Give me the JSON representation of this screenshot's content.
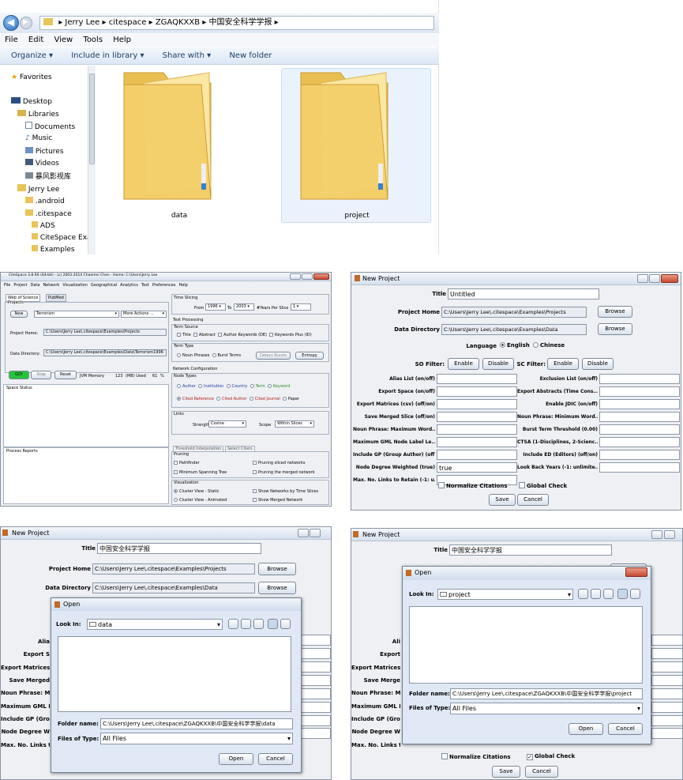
{
  "explorer": {
    "breadcrumb": [
      "Jerry Lee",
      "citespace",
      "ZGAQKXXB",
      "中国安全科学学报"
    ],
    "menu": [
      "File",
      "Edit",
      "View",
      "Tools",
      "Help"
    ],
    "toolbar": [
      "Organize",
      "Include in library",
      "Share with",
      "New folder"
    ],
    "nav": {
      "favorites": "Favorites",
      "desktop": "Desktop",
      "libraries": "Libraries",
      "documents": "Documents",
      "music": "Music",
      "pictures": "Pictures",
      "videos": "Videos",
      "baofeng": "暴风影视库",
      "user": "Jerry Lee",
      "android": ".android",
      "citespace": ".citespace",
      "ads": "ADS",
      "citespace_exa": "CiteSpace Exa",
      "examples": "Examples"
    },
    "folders": [
      "data",
      "project"
    ]
  },
  "citespace": {
    "title": "CiteSpace 3.8.R6 (64-bit) - (c) 2003-2014 Chaomei Chen - Home: C:\\Users\\Jerry Lee",
    "menu": [
      "File",
      "Project",
      "Data",
      "Network",
      "Visualization",
      "Geographical",
      "Analytics",
      "Text",
      "Preferences",
      "Help"
    ],
    "tabs": [
      "Web of Science",
      "PubMed"
    ],
    "projects_label": "Projects",
    "new_btn": "New",
    "project_name": "Terrorism",
    "more_actions": "More Actions ...",
    "project_home_label": "Project Home:",
    "project_home": "C:\\Users\\Jerry Lee\\.citespace\\Examples\\Projects",
    "data_dir_label": "Data Directory:",
    "data_dir": "C:\\Users\\Jerry Lee\\.citespace\\Examples\\Data\\Terrorism1996",
    "go": "GO!",
    "stop": "Stop",
    "reset": "Reset",
    "jvm": "JVM Memory",
    "mem": "123",
    "mb_used": "(MB) Used",
    "pct": "61",
    "pct_sign": "%",
    "space_status": "Space Status",
    "process_reports": "Process Reports",
    "time_slicing": "Time Slicing",
    "from": "From",
    "from_val": "1996",
    "to": "To",
    "to_val": "2003",
    "years_per": "#Years Per Slice",
    "yps_val": "1",
    "text_processing": "Text Processing",
    "term_source": "Term Source",
    "term_sources": [
      "Title",
      "Abstract",
      "Author Keywords (DE)",
      "Keywords Plus (ID)"
    ],
    "term_type": "Term Type",
    "term_types": [
      "Noun Phrases",
      "Burst Terms"
    ],
    "detect_bursts": "Detect Bursts",
    "entropy": "Entropy",
    "network_config": "Network Configuration",
    "node_types": "Node Types",
    "node_row1": [
      "Author",
      "Institution",
      "Country",
      "Term",
      "Keyword"
    ],
    "node_row2": [
      "Cited Reference",
      "Cited Author",
      "Cited Journal",
      "Paper"
    ],
    "links": "Links",
    "strength": "Strength",
    "strength_val": "Cosine",
    "scope": "Scope",
    "scope_val": "Within Slices",
    "tab_threshold": "Threshold Interpolation",
    "tab_select": "Select Citers",
    "pruning": "Pruning",
    "prune": [
      "Pathfinder",
      "Pruning sliced networks",
      "Minimum Spanning Tree",
      "Pruning the merged network"
    ],
    "visualization": "Visualization",
    "vis": [
      "Cluster View - Static",
      "Show Networks by Time Slices",
      "Cluster View - Animated",
      "Show Merged Network"
    ]
  },
  "newproj1": {
    "window_title": "New Project",
    "title_label": "Title",
    "title_val": "Untitled",
    "ph_label": "Project Home",
    "ph_val": "C:\\Users\\Jerry Lee\\.citespace\\Examples\\Projects",
    "browse": "Browse",
    "dd_label": "Data Directory",
    "dd_val": "C:\\Users\\Jerry Lee\\.citespace\\Examples\\Data",
    "lang_label": "Language",
    "lang_en": "English",
    "lang_cn": "Chinese",
    "so_label": "SO Filter:",
    "sc_label": "SC Filter:",
    "enable": "Enable",
    "disable": "Disable",
    "left_labels": [
      "Alias List (on/off)",
      "Export Space (on/off)",
      "Export Matrices (csv) (off/on)",
      "Save Merged Slice (off/on)",
      "Noun Phrase: Maximum Word...",
      "Maximum GML Node Label Le...",
      "Include GP (Group Author) (off...",
      "Node Degree Weighted (true)",
      "Max. No. Links to Retain (-1: u..."
    ],
    "left_vals": [
      "",
      "",
      "",
      "",
      "",
      "",
      "",
      "true",
      ""
    ],
    "right_labels": [
      "Exclusion List (on/off)",
      "Export Abstracts (Time Cons...",
      "Enable JDIC (on/off)",
      "Noun Phrase: Minimum Word...",
      "Burst Term Threshold (0.00)",
      "CTSA (1-Disciplines, 2-Scienc...",
      "Include ED (Editors) (off/on)",
      "Look Back Years (-1: unlimite..."
    ],
    "normalize": "Normalize Citations",
    "global": "Global Check",
    "save": "Save",
    "cancel": "Cancel"
  },
  "newproj2": {
    "window_title": "New Project",
    "title_label": "Title",
    "title_val": "中国安全科学学报",
    "ph_label": "Project Home",
    "ph_val": "C:\\Users\\Jerry Lee\\.citespace\\Examples\\Projects",
    "browse": "Browse",
    "dd_label": "Data Directory",
    "dd_val": "C:\\Users\\Jerry Lee\\.citespace\\Examples\\Data",
    "bg_labels": [
      "Alia",
      "Export S",
      "Export Matrices",
      "Save Merged",
      "Noun Phrase: Max",
      "Maximum GML N",
      "Include GP (Grou",
      "Node Degree W",
      "Max. No. Links to"
    ],
    "open": {
      "title": "Open",
      "look_in": "Look In:",
      "look_val": "data",
      "folder_name": "Folder name:",
      "folder_val": "C:\\Users\\Jerry Lee\\.citespace\\ZGAQKXXB\\中国安全科学学报\\data",
      "files_type": "Files of Type:",
      "files_val": "All Files",
      "open_btn": "Open",
      "cancel_btn": "Cancel"
    }
  },
  "newproj3": {
    "window_title": "New Project",
    "title_label": "Title",
    "title_val": "中国安全科学学报",
    "bg_labels": [
      "Ali",
      "Export",
      "Export Matrices",
      "Save Merge",
      "Noun Phrase: Max",
      "Maximum GML N",
      "Include GP (Grou",
      "Node Degree W",
      "Max. No. Links to"
    ],
    "open": {
      "title": "Open",
      "look_in": "Look In:",
      "look_val": "project",
      "folder_name": "Folder name:",
      "folder_val": "C:\\Users\\Jerry Lee\\.citespace\\ZGAQKXXB\\中国安全科学学报\\project",
      "files_type": "Files of Type:",
      "files_val": "All Files",
      "open_btn": "Open",
      "cancel_btn": "Cancel"
    },
    "normalize": "Normalize Citations",
    "global": "Global Check",
    "save": "Save",
    "cancel": "Cancel"
  }
}
